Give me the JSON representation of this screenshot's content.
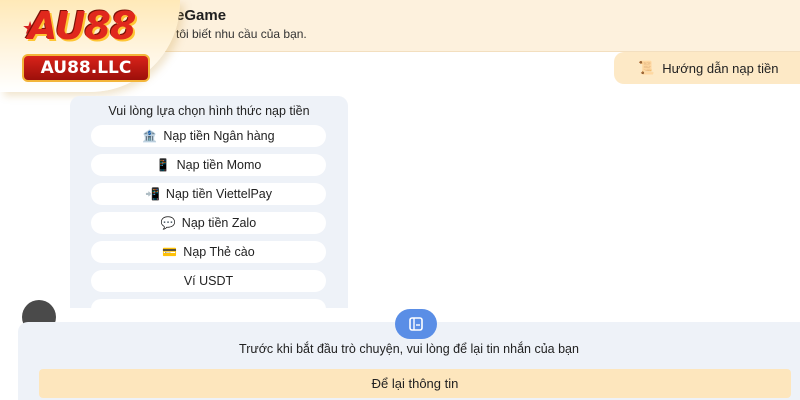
{
  "header": {
    "title": "eGame",
    "subtitle": "tôi biết nhu cầu của bạn."
  },
  "logo": {
    "text": "AU88",
    "badge": "AU88.LLC",
    "colors": {
      "primary": "#e0281d",
      "accent": "#ffc533"
    }
  },
  "guide_button": {
    "label": "Hướng dẫn nạp tiền",
    "icon": "scroll-icon"
  },
  "options_panel": {
    "title": "Vui lòng lựa chọn hình thức nạp tiền",
    "options": [
      {
        "label": "Nạp tiền Ngân hàng",
        "icon": "bank-icon"
      },
      {
        "label": "Nạp tiền Momo",
        "icon": "phone-icon"
      },
      {
        "label": "Nạp tiền ViettelPay",
        "icon": "mobile-pay-icon"
      },
      {
        "label": "Nạp tiền Zalo",
        "icon": "chat-icon"
      },
      {
        "label": "Nạp Thẻ cào",
        "icon": "card-icon"
      },
      {
        "label": "Ví USDT",
        "icon": ""
      }
    ]
  },
  "bottom_prompt": {
    "text": "Trước khi bắt đầu trò chuyện, vui lòng để lại tin nhắn của bạn",
    "button_label": "Để lại thông tin",
    "icon": "form-icon",
    "colors": {
      "accent": "#5a8ee6",
      "button": "#fde6bd"
    }
  }
}
